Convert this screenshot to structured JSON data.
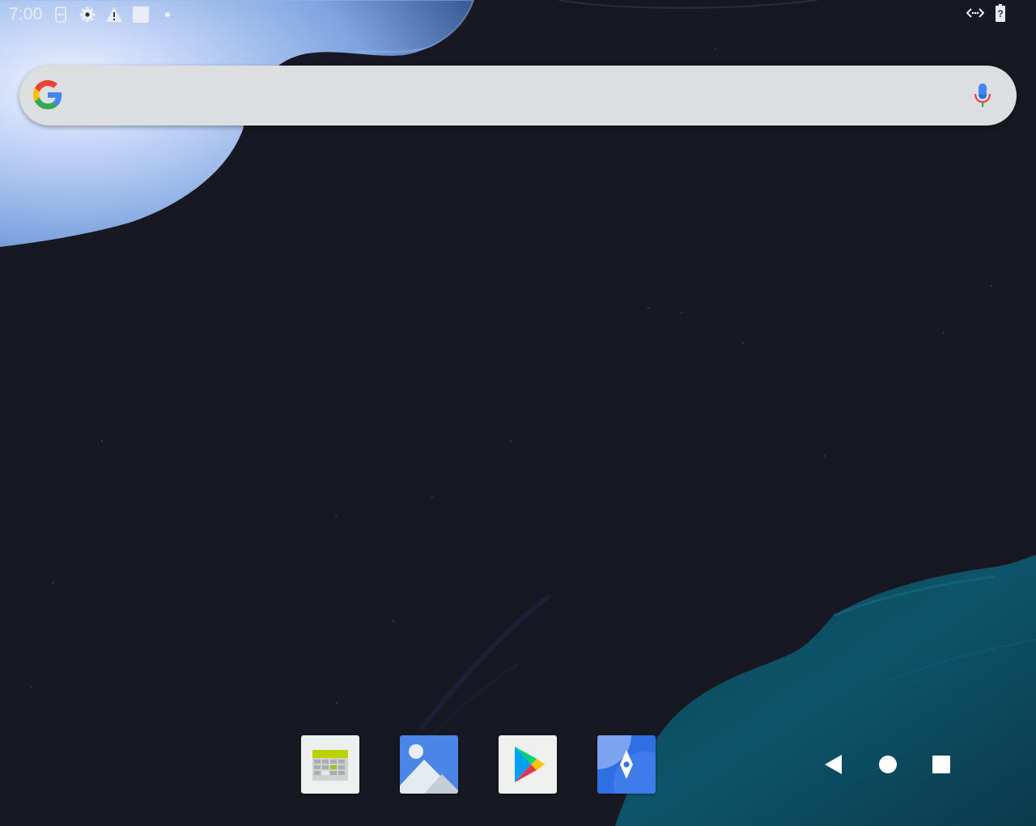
{
  "status_bar": {
    "time": "7:00",
    "left_icons": [
      "sim-card-icon",
      "settings-gear-icon",
      "warning-icon",
      "notification-square-icon",
      "notification-dot-icon"
    ],
    "right_icons": [
      "data-transfer-icon",
      "battery-unknown-icon"
    ]
  },
  "search": {
    "placeholder": "",
    "value": "",
    "logo_icon": "google-g-icon",
    "voice_icon": "microphone-icon"
  },
  "dock": {
    "apps": [
      {
        "name": "calendar-app",
        "icon": "calendar-grid-icon"
      },
      {
        "name": "gallery-app",
        "icon": "photo-gallery-icon"
      },
      {
        "name": "play-store-app",
        "icon": "play-store-icon"
      },
      {
        "name": "compass-app",
        "icon": "compass-icon"
      }
    ]
  },
  "navigation": {
    "buttons": [
      "back-triangle-icon",
      "home-circle-icon",
      "recents-square-icon"
    ]
  },
  "colors": {
    "wallpaper_background": "#171821",
    "search_bar_background": "#dcdedf",
    "status_icon_color": "#e8ecf4",
    "wallpaper_blue_accent": "#7ea3df",
    "wallpaper_teal_accent": "#0f4f63"
  }
}
